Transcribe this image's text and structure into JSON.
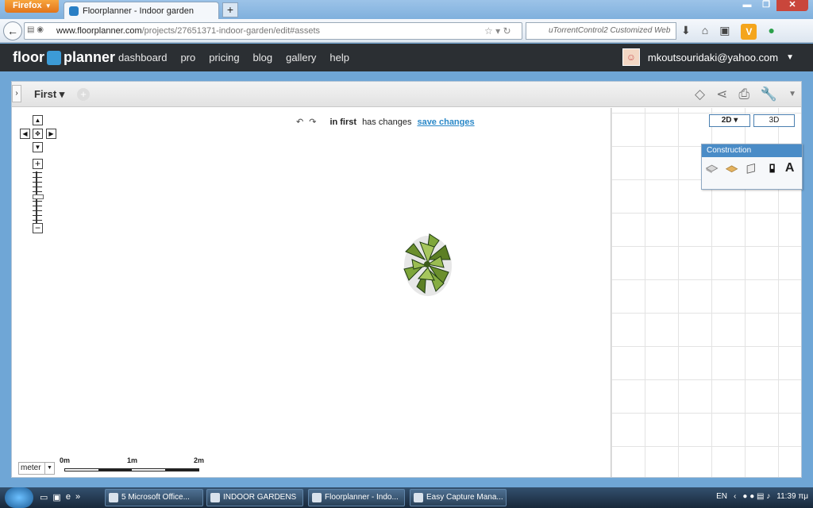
{
  "browser": {
    "menu_button": "Firefox",
    "tab_title": "Floorplanner - Indoor garden",
    "new_tab": "+",
    "url_domain": "www.floorplanner.com",
    "url_path": "/projects/27651371-indoor-garden/edit#assets",
    "search_placeholder": "uTorrentControl2 Customized Web"
  },
  "site": {
    "logo_left": "floor",
    "logo_right": "planner",
    "nav": [
      "dashboard",
      "pro",
      "pricing",
      "blog",
      "gallery",
      "help"
    ],
    "user_email": "mkoutsouridaki@yahoo.com"
  },
  "editor": {
    "floor_name": "First",
    "status_floor": "in first",
    "status_text": "has changes",
    "save_link": "save changes",
    "view_2d": "2D",
    "view_3d": "3D",
    "construction_title": "Construction",
    "unit": "meter",
    "scale_labels": [
      "0m",
      "1m",
      "2m"
    ]
  },
  "taskbar": {
    "buttons": [
      "5 Microsoft Office...",
      "INDOOR GARDENS",
      "Floorplanner - Indo...",
      "Easy Capture Mana..."
    ],
    "lang": "EN",
    "clock": "11:39 πμ"
  },
  "colors": {
    "accent": "#2a88c8",
    "header": "#2b2f33",
    "ff_orange": "#e2741b"
  }
}
